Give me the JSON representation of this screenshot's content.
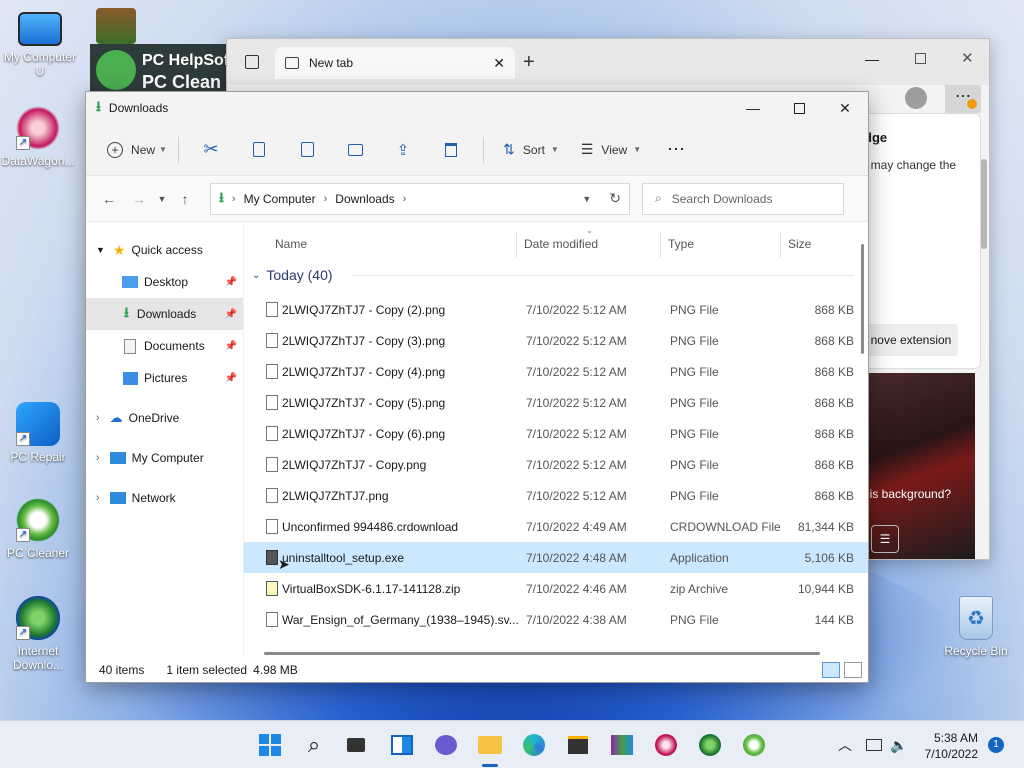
{
  "desktop": {
    "icons": [
      {
        "label": "My Computer U"
      },
      {
        "label": "DataWagon..."
      },
      {
        "label": "PC Repair"
      },
      {
        "label": "PC Cleaner"
      },
      {
        "label": "Internet Downlo..."
      },
      {
        "label": "Recycle Bin"
      }
    ],
    "helpsoft_line1": "PC HelpSoft",
    "helpsoft_line2": "PC Clean"
  },
  "edge": {
    "tab_title": "New tab",
    "panel_heading": "dge",
    "panel_text": "t may change the",
    "panel_button": "nove extension",
    "bg_text": "his background?"
  },
  "explorer": {
    "title": "Downloads",
    "toolbar": {
      "new_label": "New",
      "sort_label": "Sort",
      "view_label": "View"
    },
    "breadcrumb": [
      "My Computer",
      "Downloads"
    ],
    "search_placeholder": "Search Downloads",
    "nav": {
      "quick_access": "Quick access",
      "desktop": "Desktop",
      "downloads": "Downloads",
      "documents": "Documents",
      "pictures": "Pictures",
      "onedrive": "OneDrive",
      "mycomputer": "My Computer",
      "network": "Network"
    },
    "columns": {
      "name": "Name",
      "date": "Date modified",
      "type": "Type",
      "size": "Size"
    },
    "group_label": "Today (40)",
    "files": [
      {
        "name": "2LWIQJ7ZhTJ7 - Copy (2).png",
        "date": "7/10/2022 5:12 AM",
        "type": "PNG File",
        "size": "868 KB"
      },
      {
        "name": "2LWIQJ7ZhTJ7 - Copy (3).png",
        "date": "7/10/2022 5:12 AM",
        "type": "PNG File",
        "size": "868 KB"
      },
      {
        "name": "2LWIQJ7ZhTJ7 - Copy (4).png",
        "date": "7/10/2022 5:12 AM",
        "type": "PNG File",
        "size": "868 KB"
      },
      {
        "name": "2LWIQJ7ZhTJ7 - Copy (5).png",
        "date": "7/10/2022 5:12 AM",
        "type": "PNG File",
        "size": "868 KB"
      },
      {
        "name": "2LWIQJ7ZhTJ7 - Copy (6).png",
        "date": "7/10/2022 5:12 AM",
        "type": "PNG File",
        "size": "868 KB"
      },
      {
        "name": "2LWIQJ7ZhTJ7 - Copy.png",
        "date": "7/10/2022 5:12 AM",
        "type": "PNG File",
        "size": "868 KB"
      },
      {
        "name": "2LWIQJ7ZhTJ7.png",
        "date": "7/10/2022 5:12 AM",
        "type": "PNG File",
        "size": "868 KB"
      },
      {
        "name": "Unconfirmed 994486.crdownload",
        "date": "7/10/2022 4:49 AM",
        "type": "CRDOWNLOAD File",
        "size": "81,344 KB"
      },
      {
        "name": "uninstalltool_setup.exe",
        "date": "7/10/2022 4:48 AM",
        "type": "Application",
        "size": "5,106 KB"
      },
      {
        "name": "VirtualBoxSDK-6.1.17-141128.zip",
        "date": "7/10/2022 4:46 AM",
        "type": "zip Archive",
        "size": "10,944 KB"
      },
      {
        "name": "War_Ensign_of_Germany_(1938–1945).sv...",
        "date": "7/10/2022 4:38 AM",
        "type": "PNG File",
        "size": "144 KB"
      }
    ],
    "status": {
      "count": "40 items",
      "selected": "1 item selected",
      "selected_size": "4.98 MB"
    }
  },
  "taskbar": {
    "time": "5:38 AM",
    "date": "7/10/2022",
    "notifications": "1"
  }
}
